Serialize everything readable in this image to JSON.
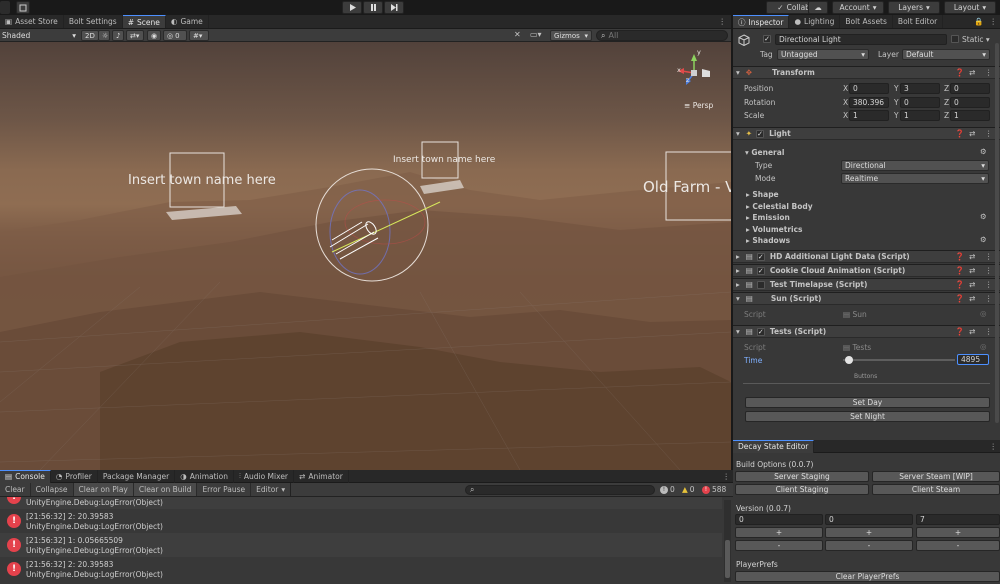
{
  "topbar": {
    "collab": "Collab",
    "account": "Account",
    "layers": "Layers",
    "layout": "Layout",
    "play_icon": "play-icon",
    "pause_icon": "pause-icon",
    "step_icon": "step-icon"
  },
  "left_tabs": [
    "Asset Store",
    "Bolt Settings",
    "Scene",
    "Game"
  ],
  "scene_toolbar": {
    "shading": "Shaded",
    "mode_2d": "2D",
    "hidden_count": "0",
    "gizmos": "Gizmos",
    "search_placeholder": "All"
  },
  "scene": {
    "label_town_1": "Insert town name here",
    "label_town_2": "Insert town name here",
    "label_farm": "Old Farm - V",
    "persp": "Persp",
    "axis_x": "x",
    "axis_y": "y",
    "axis_z": "z"
  },
  "right_tabs": [
    "Inspector",
    "Lighting",
    "Bolt Assets",
    "Bolt Editor"
  ],
  "inspector": {
    "object_name": "Directional Light",
    "static_label": "Static",
    "tag_label": "Tag",
    "tag_value": "Untagged",
    "layer_label": "Layer",
    "layer_value": "Default",
    "transform": {
      "title": "Transform",
      "position_label": "Position",
      "rotation_label": "Rotation",
      "scale_label": "Scale",
      "position": {
        "x": "0",
        "y": "3",
        "z": "0"
      },
      "rotation": {
        "x": "380.396",
        "y": "0",
        "z": "0"
      },
      "scale": {
        "x": "1",
        "y": "1",
        "z": "1"
      }
    },
    "light": {
      "title": "Light",
      "general": "General",
      "type_label": "Type",
      "type_value": "Directional",
      "mode_label": "Mode",
      "mode_value": "Realtime",
      "sections": [
        "Shape",
        "Celestial Body",
        "Emission",
        "Volumetrics",
        "Shadows"
      ]
    },
    "components": [
      "HD Additional Light Data (Script)",
      "Cookie Cloud Animation (Script)",
      "Test Timelapse (Script)",
      "Sun (Script)"
    ],
    "sun_script_label": "Script",
    "sun_script_value": "Sun",
    "tests": {
      "title": "Tests (Script)",
      "script_label": "Script",
      "script_value": "Tests",
      "time_label": "Time",
      "time_fraction": 0.02,
      "time_value": "4895",
      "buttons_header": "Buttons",
      "set_day": "Set Day",
      "set_night": "Set Night"
    }
  },
  "decay": {
    "tab": "Decay State Editor",
    "build_options": "Build Options (0.0.7)",
    "server_staging": "Server Staging",
    "server_steam": "Server Steam [WIP]",
    "client_staging": "Client Staging",
    "client_steam": "Client Steam",
    "version_label": "Version (0.0.7)",
    "version": [
      "0",
      "0",
      "7"
    ],
    "plus": "+",
    "minus": "-",
    "playerprefs_label": "PlayerPrefs",
    "clear_playerprefs": "Clear PlayerPrefs"
  },
  "bottom_tabs": [
    "Console",
    "Profiler",
    "Package Manager",
    "Animation",
    "Audio Mixer",
    "Animator"
  ],
  "console": {
    "clear": "Clear",
    "collapse": "Collapse",
    "clear_on_play": "Clear on Play",
    "clear_on_build": "Clear on Build",
    "error_pause": "Error Pause",
    "editor": "Editor",
    "info_count": "0",
    "warn_count": "0",
    "error_count": "588",
    "logs": [
      {
        "line1": "",
        "line2": "UnityEngine.Debug:LogError(Object)"
      },
      {
        "line1": "[21:56:32] 2: 20.39583",
        "line2": "UnityEngine.Debug:LogError(Object)"
      },
      {
        "line1": "[21:56:32] 1: 0.05665509",
        "line2": "UnityEngine.Debug:LogError(Object)"
      },
      {
        "line1": "[21:56:32] 2: 20.39583",
        "line2": "UnityEngine.Debug:LogError(Object)"
      }
    ]
  },
  "colors": {
    "accent": "#4d90ff",
    "error": "#e4424c",
    "panel": "#383838"
  }
}
